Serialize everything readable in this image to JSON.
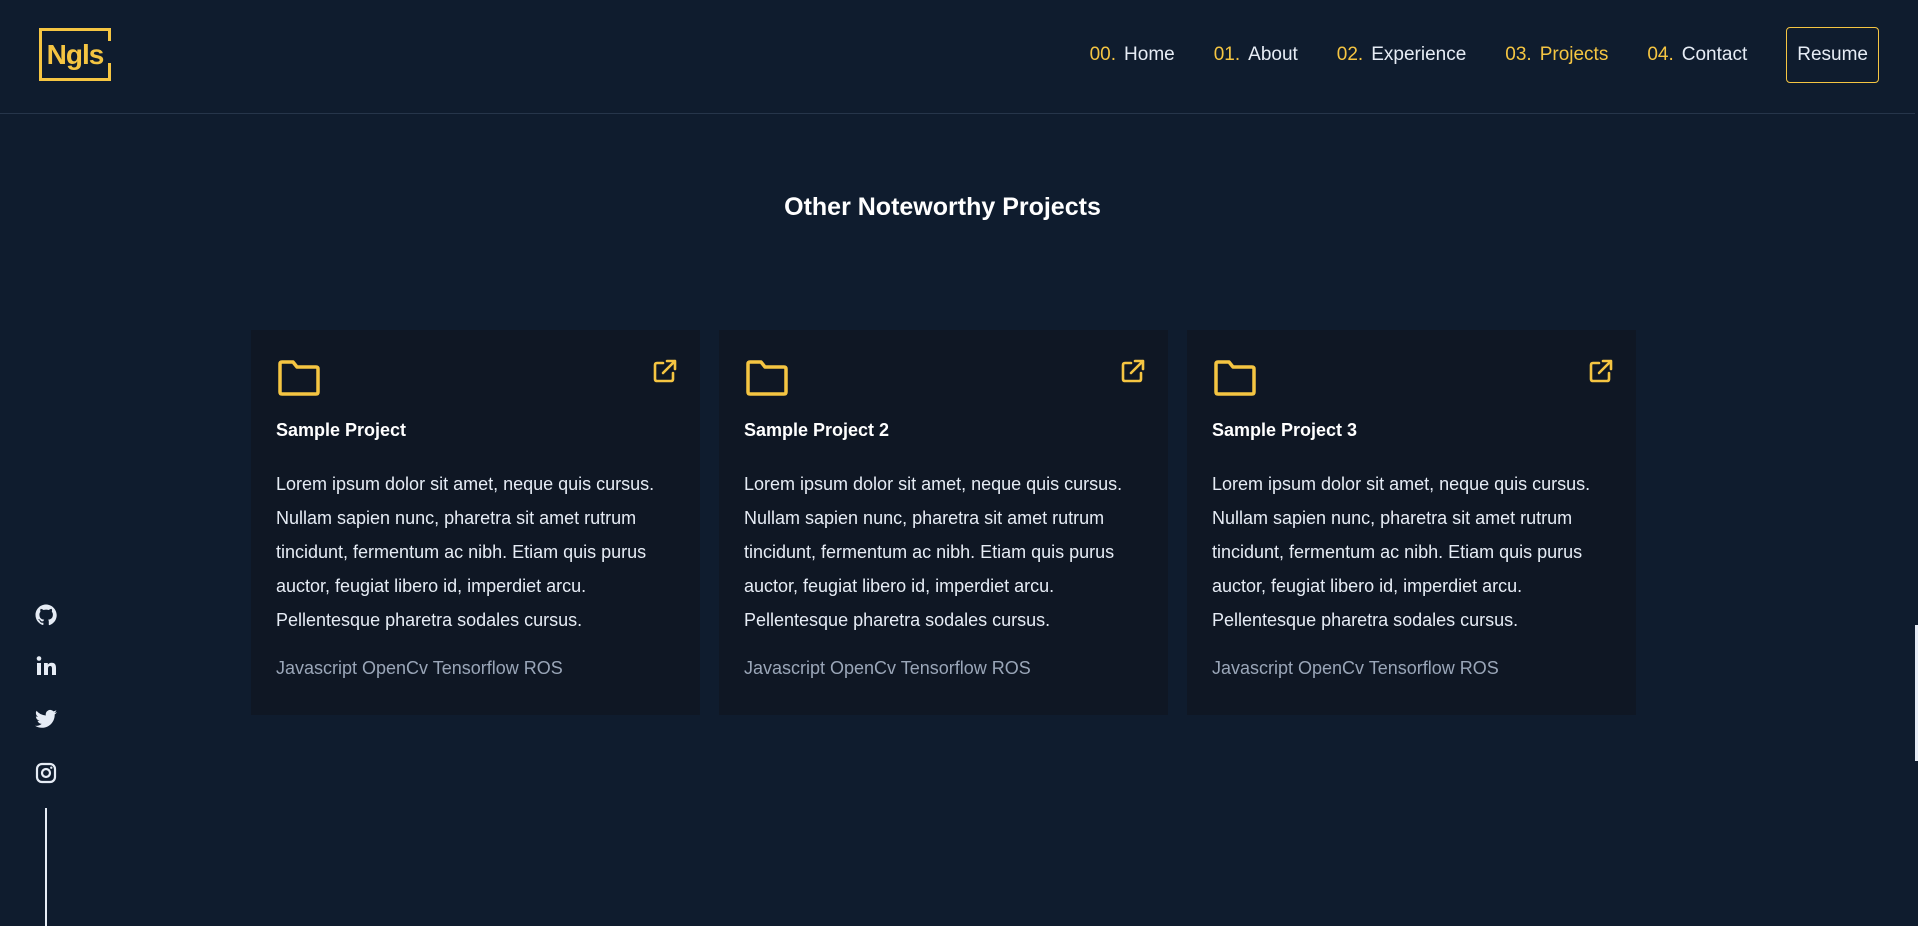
{
  "logo": {
    "text": "Ngls"
  },
  "nav": {
    "items": [
      {
        "num": "00.",
        "label": "Home"
      },
      {
        "num": "01.",
        "label": "About"
      },
      {
        "num": "02.",
        "label": "Experience"
      },
      {
        "num": "03.",
        "label": "Projects"
      },
      {
        "num": "04.",
        "label": "Contact"
      }
    ],
    "active": "Projects",
    "resume_label": "Resume"
  },
  "section": {
    "title": "Other Noteworthy Projects"
  },
  "projects": [
    {
      "title": "Sample Project",
      "description": "Lorem ipsum dolor sit amet, neque quis cursus. Nullam sapien nunc, pharetra sit amet rutrum tincidunt, fermentum ac nibh. Etiam quis purus auctor, feugiat libero id, imperdiet arcu. Pellentesque pharetra sodales cursus.",
      "tech": "Javascript OpenCv Tensorflow ROS"
    },
    {
      "title": "Sample Project 2",
      "description": "Lorem ipsum dolor sit amet, neque quis cursus. Nullam sapien nunc, pharetra sit amet rutrum tincidunt, fermentum ac nibh. Etiam quis purus auctor, feugiat libero id, imperdiet arcu. Pellentesque pharetra sodales cursus.",
      "tech": "Javascript OpenCv Tensorflow ROS"
    },
    {
      "title": "Sample Project 3",
      "description": "Lorem ipsum dolor sit amet, neque quis cursus. Nullam sapien nunc, pharetra sit amet rutrum tincidunt, fermentum ac nibh. Etiam quis purus auctor, feugiat libero id, imperdiet arcu. Pellentesque pharetra sodales cursus.",
      "tech": "Javascript OpenCv Tensorflow ROS"
    }
  ],
  "socials": [
    "github-icon",
    "linkedin-icon",
    "twitter-icon",
    "instagram-icon"
  ],
  "colors": {
    "background": "#0f1c2e",
    "card": "#0f1724",
    "accent": "#f5c542",
    "text": "#e6ecf5",
    "muted": "#9aa6b8"
  }
}
